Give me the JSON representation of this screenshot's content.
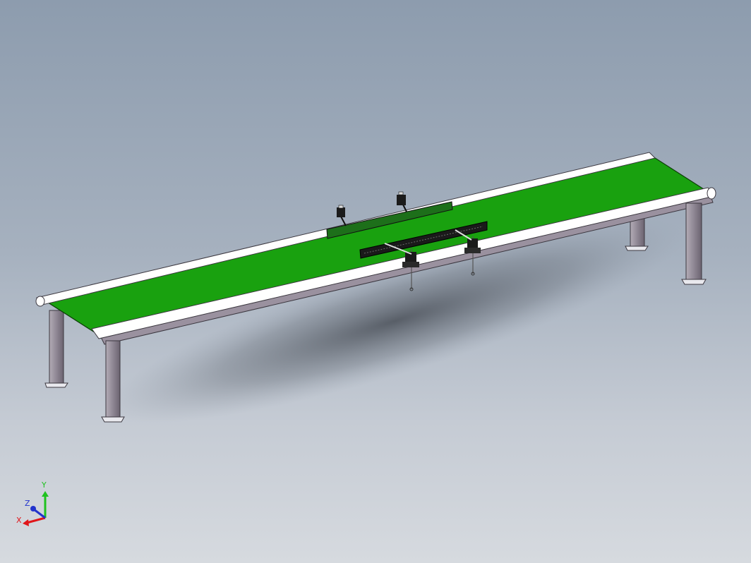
{
  "viewport": {
    "background_top": "#8d9cae",
    "background_bottom": "#d6dadf"
  },
  "model": {
    "belt_color": "#19a10f",
    "frame_color": "#8f8794",
    "roller_color": "#ffffff",
    "guide_color": "#1d6f1a"
  },
  "triad": {
    "x_label": "X",
    "y_label": "Y",
    "z_label": "Z",
    "x_color": "#e0161a",
    "y_color": "#1fc21f",
    "z_color": "#2233cc"
  }
}
